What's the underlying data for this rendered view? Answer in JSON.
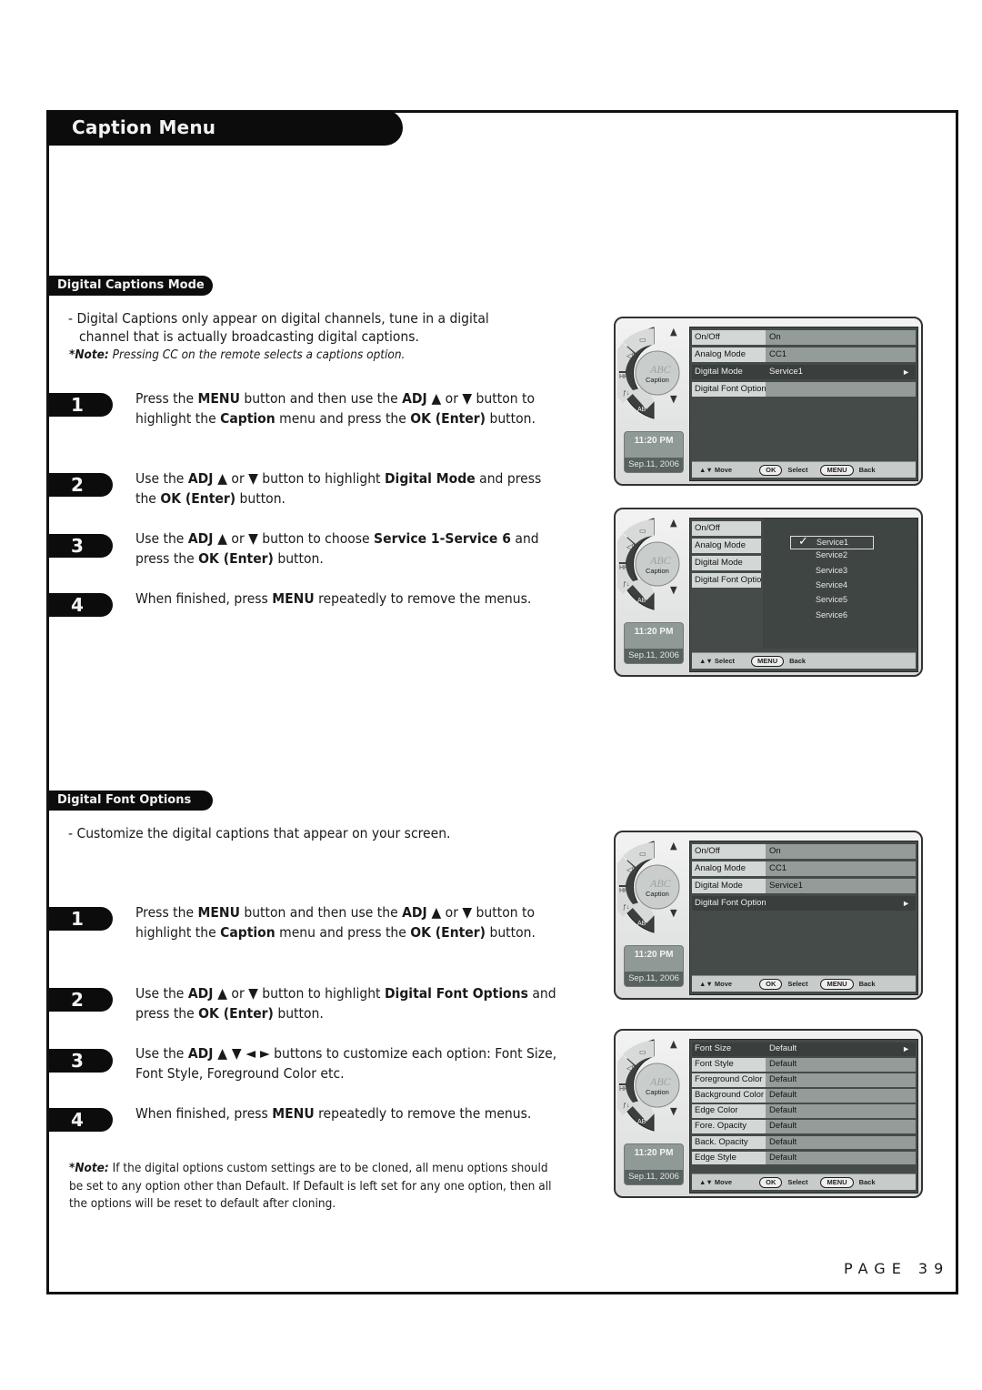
{
  "page": {
    "title": "Caption Menu",
    "page_label": "PAGE 39"
  },
  "section1": {
    "heading": "Digital Captions Mode",
    "intro_line1": "- Digital Captions only appear on digital channels, tune in a digital",
    "intro_line2": "channel that is actually broadcasting digital captions.",
    "note_label": "*Note:",
    "note_text": "Pressing CC on the remote selects a captions option.",
    "steps": [
      {
        "number": "1",
        "html": "Press the <b>MENU</b> button and then use the <b>ADJ ▲</b> or <b>▼</b> button to highlight the <b>Caption</b> menu and press the <b>OK (Enter)</b> button."
      },
      {
        "number": "2",
        "html": "Use the <b>ADJ ▲</b> or <b>▼</b> button to highlight <b>Digital Mode</b> and press the <b>OK (Enter)</b> button."
      },
      {
        "number": "3",
        "html": "Use the <b>ADJ ▲</b> or <b>▼</b> button to choose <b>Service 1-Service 6</b> and press the <b>OK (Enter)</b> button."
      },
      {
        "number": "4",
        "html": "When finished, press <b>MENU</b> repeatedly to remove the menus."
      }
    ]
  },
  "section2": {
    "heading": "Digital Font Options",
    "intro": "- Customize the digital captions that appear on your screen.",
    "steps": [
      {
        "number": "1",
        "html": "Press the <b>MENU</b> button and then use the <b>ADJ ▲</b> or <b>▼</b> button to highlight the <b>Caption</b> menu and press the <b>OK (Enter)</b> button."
      },
      {
        "number": "2",
        "html": "Use the <b>ADJ ▲</b> or <b>▼</b> button to highlight <b>Digital Font Options</b> and press the <b>OK (Enter)</b> button."
      },
      {
        "number": "3",
        "html": "Use the <b>ADJ ▲ ▼ ◄ ►</b> buttons to customize each option: Font Size, Font Style, Foreground Color etc."
      },
      {
        "number": "4",
        "html": "When finished, press <b>MENU</b> repeatedly to remove the menus."
      }
    ],
    "note_label": "*Note:",
    "note_text": "If the digital options custom settings are to be cloned, all menu options should be set to any option other than Default. If Default is left set for any one option, then all the options will be reset to default after cloning."
  },
  "osd_common": {
    "time": "11:20 PM",
    "date": "Sep.11, 2006",
    "wheel_center_label": "Caption",
    "wheel_center_glyph": "ABC",
    "wheel_ab_label": "AB",
    "footer_move": "▲▼ Move",
    "footer_select_key": "OK",
    "footer_select": "Select",
    "footer_back_key": "MENU",
    "footer_back": "Back",
    "footer_select_only": "▲▼ Select"
  },
  "osd1": {
    "rows": [
      {
        "label": "On/Off",
        "value": "On",
        "selected": false
      },
      {
        "label": "Analog Mode",
        "value": "CC1",
        "selected": false
      },
      {
        "label": "Digital Mode",
        "value": "Service1",
        "selected": true
      },
      {
        "label": "Digital Font Option",
        "value": "",
        "selected": false
      }
    ]
  },
  "osd2": {
    "rows": [
      {
        "label": "On/Off"
      },
      {
        "label": "Analog Mode"
      },
      {
        "label": "Digital Mode"
      },
      {
        "label": "Digital Font Option"
      }
    ],
    "services": [
      "Service1",
      "Service2",
      "Service3",
      "Service4",
      "Service5",
      "Service6"
    ],
    "checked_index": 0
  },
  "osd3": {
    "rows": [
      {
        "label": "On/Off",
        "value": "On",
        "selected": false
      },
      {
        "label": "Analog Mode",
        "value": "CC1",
        "selected": false
      },
      {
        "label": "Digital Mode",
        "value": "Service1",
        "selected": false
      },
      {
        "label": "Digital Font Option",
        "value": "",
        "selected": true
      }
    ]
  },
  "osd4": {
    "rows": [
      {
        "label": "Font Size",
        "value": "Default",
        "selected": true
      },
      {
        "label": "Font Style",
        "value": "Default",
        "selected": false
      },
      {
        "label": "Foreground Color",
        "value": "Default",
        "selected": false
      },
      {
        "label": "Background Color",
        "value": "Default",
        "selected": false
      },
      {
        "label": "Edge Color",
        "value": "Default",
        "selected": false
      },
      {
        "label": "Fore. Opacity",
        "value": "Default",
        "selected": false
      },
      {
        "label": "Back. Opacity",
        "value": "Default",
        "selected": false
      },
      {
        "label": "Edge Style",
        "value": "Default",
        "selected": false
      }
    ]
  }
}
